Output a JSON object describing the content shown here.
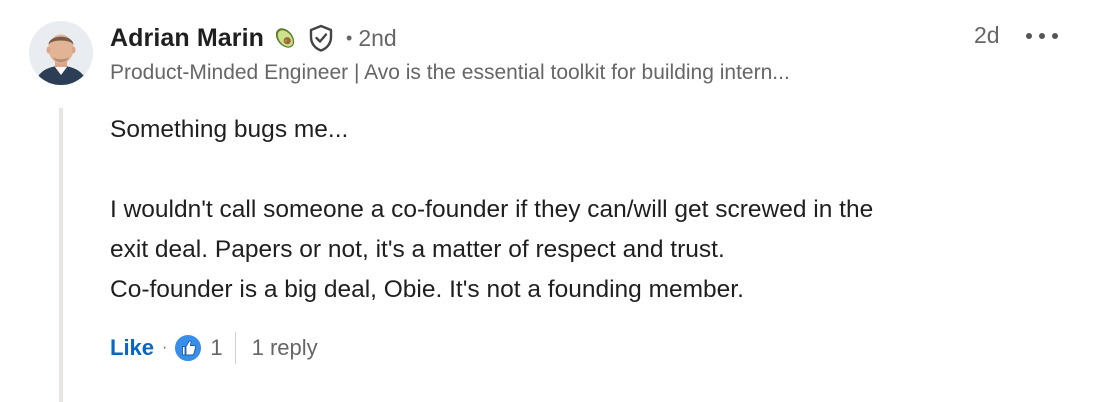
{
  "comment": {
    "author": {
      "name": "Adrian Marin",
      "badges": [
        "avocado-icon",
        "verified-shield-icon"
      ],
      "connection_separator": "•",
      "connection_degree": "2nd",
      "headline": "Product-Minded Engineer | Avo is the essential toolkit for building intern..."
    },
    "timestamp": "2d",
    "body": {
      "lines": [
        "Something bugs me...",
        "",
        "I wouldn't call someone a co-founder if they can/will get screwed in the",
        "exit deal. Papers or not, it's a matter of respect and trust.",
        "Co-founder is a big deal, Obie. It's not a founding member."
      ]
    },
    "actions": {
      "like_label": "Like",
      "separator": "·",
      "reaction_icon": "like-reaction-icon",
      "reaction_count": "1",
      "reply_label": "1 reply"
    }
  },
  "colors": {
    "link_blue": "#0a66c2",
    "text_primary": "#1f1f1f",
    "text_secondary": "#666666",
    "thread_line": "#e8e4df"
  }
}
